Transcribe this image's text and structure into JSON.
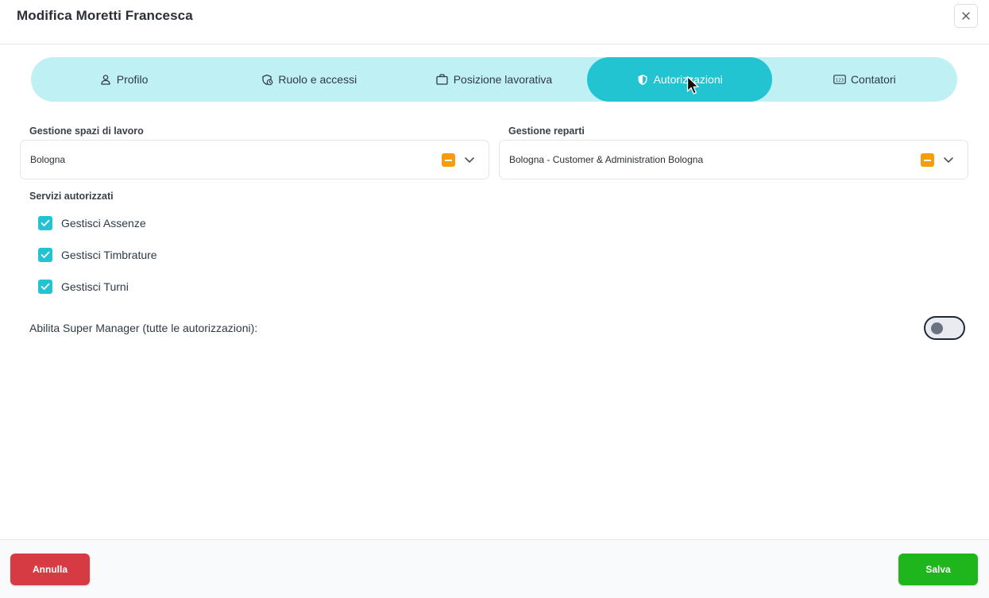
{
  "dialog": {
    "title": "Modifica Moretti Francesca"
  },
  "tabs": [
    {
      "label": "Profilo",
      "icon": "user-icon"
    },
    {
      "label": "Ruolo e accessi",
      "icon": "role-access-icon"
    },
    {
      "label": "Posizione lavorativa",
      "icon": "briefcase-icon"
    },
    {
      "label": "Autorizzazioni",
      "icon": "shield-icon",
      "active": true
    },
    {
      "label": "Contatori",
      "icon": "counter-icon"
    }
  ],
  "workspaces": {
    "label": "Gestione spazi di lavoro",
    "value": "Bologna"
  },
  "departments": {
    "label": "Gestione reparti",
    "value": "Bologna - Customer & Administration Bologna"
  },
  "services": {
    "label": "Servizi autorizzati",
    "items": [
      {
        "label": "Gestisci Assenze",
        "checked": true
      },
      {
        "label": "Gestisci Timbrature",
        "checked": true
      },
      {
        "label": "Gestisci Turni",
        "checked": true
      }
    ]
  },
  "super_manager": {
    "label": "Abilita Super Manager (tutte le autorizzazioni):",
    "enabled": false
  },
  "footer": {
    "cancel_label": "Annulla",
    "save_label": "Salva"
  },
  "colors": {
    "accent": "#22c4d1",
    "tab_bg": "#bff0f3",
    "danger": "#d63b43",
    "success": "#1fb51c",
    "indeterminate": "#f59e0b"
  }
}
